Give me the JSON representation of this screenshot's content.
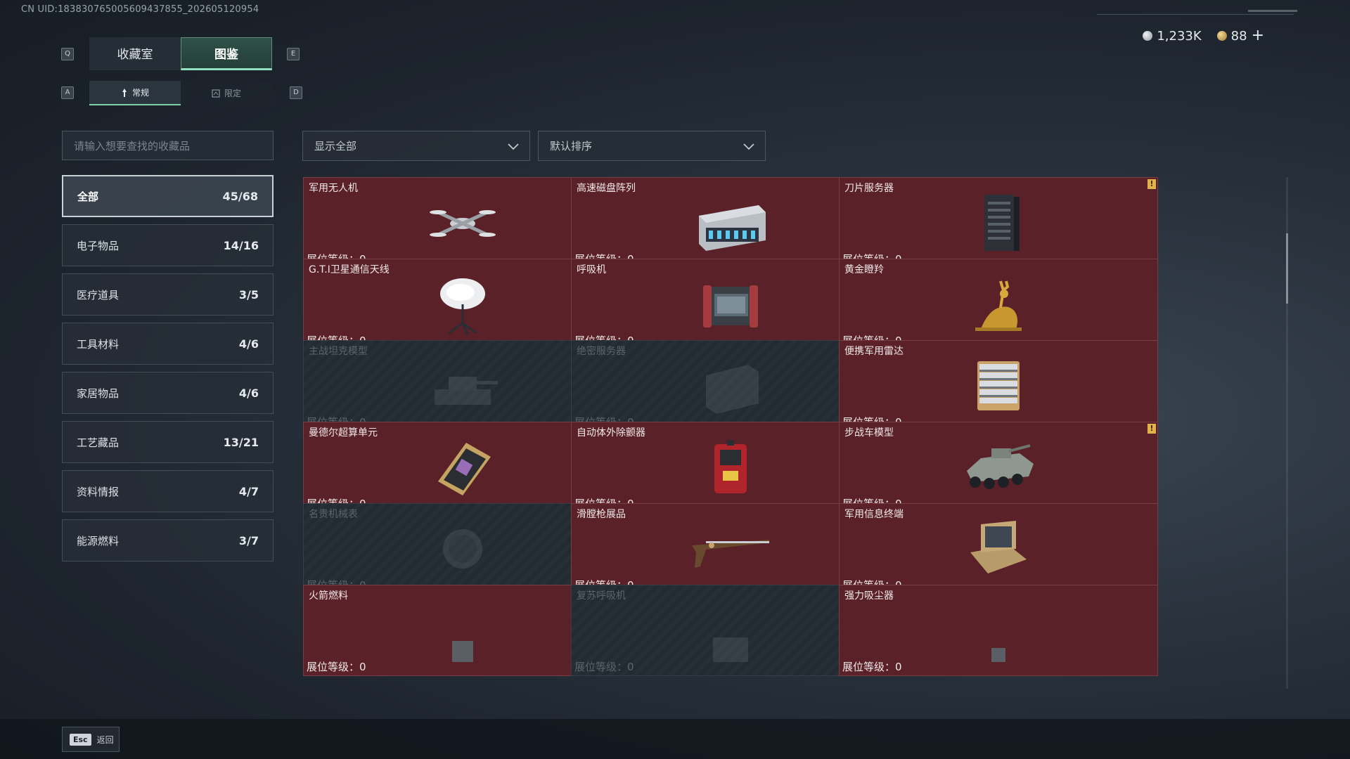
{
  "uid_text": "CN UID:183830765005609437855_202605120954",
  "currency": {
    "silver": "1,233K",
    "gold": "88",
    "plus": "+"
  },
  "keys": {
    "q": "Q",
    "e": "E",
    "a": "A",
    "d": "D"
  },
  "tabs": [
    {
      "label": "收藏室",
      "active": false
    },
    {
      "label": "图鉴",
      "active": true
    }
  ],
  "subtabs": [
    {
      "label": "常规",
      "active": true
    },
    {
      "label": "限定",
      "active": false
    }
  ],
  "search": {
    "placeholder": "请输入想要查找的收藏品"
  },
  "categories": [
    {
      "label": "全部",
      "count": "45/68",
      "active": true
    },
    {
      "label": "电子物品",
      "count": "14/16"
    },
    {
      "label": "医疗道具",
      "count": "3/5"
    },
    {
      "label": "工具材料",
      "count": "4/6"
    },
    {
      "label": "家居物品",
      "count": "4/6"
    },
    {
      "label": "工艺藏品",
      "count": "13/21"
    },
    {
      "label": "资料情报",
      "count": "4/7"
    },
    {
      "label": "能源燃料",
      "count": "3/7"
    }
  ],
  "filter": {
    "show": "显示全部",
    "sort": "默认排序"
  },
  "level_label": "展位等级：0",
  "items": [
    {
      "name": "军用无人机",
      "icon": "drone-icon",
      "locked": false,
      "mark": false
    },
    {
      "name": "高速磁盘阵列",
      "icon": "disk-array-icon",
      "locked": false,
      "mark": false
    },
    {
      "name": "刀片服务器",
      "icon": "blade-server-icon",
      "locked": false,
      "mark": true
    },
    {
      "name": "G.T.I卫星通信天线",
      "icon": "satellite-dish-icon",
      "locked": false,
      "mark": true
    },
    {
      "name": "呼吸机",
      "icon": "ventilator-icon",
      "locked": false,
      "mark": false
    },
    {
      "name": "黄金瞪羚",
      "icon": "golden-gazelle-icon",
      "locked": false,
      "mark": false
    },
    {
      "name": "主战坦克模型",
      "icon": "tank-model-icon",
      "locked": true,
      "mark": false
    },
    {
      "name": "绝密服务器",
      "icon": "secret-server-icon",
      "locked": true,
      "mark": false
    },
    {
      "name": "便携军用雷达",
      "icon": "portable-radar-icon",
      "locked": false,
      "mark": false
    },
    {
      "name": "曼德尔超算单元",
      "icon": "supercomputer-unit-icon",
      "locked": false,
      "mark": false
    },
    {
      "name": "自动体外除颤器",
      "icon": "defibrillator-icon",
      "locked": false,
      "mark": false
    },
    {
      "name": "步战车模型",
      "icon": "ifv-model-icon",
      "locked": false,
      "mark": true
    },
    {
      "name": "名贵机械表",
      "icon": "mechanical-watch-icon",
      "locked": true,
      "mark": false
    },
    {
      "name": "滑膛枪展品",
      "icon": "musket-icon",
      "locked": false,
      "mark": true
    },
    {
      "name": "军用信息终端",
      "icon": "info-terminal-icon",
      "locked": false,
      "mark": false
    },
    {
      "name": "火箭燃料",
      "icon": "rocket-fuel-icon",
      "locked": false,
      "mark": true
    },
    {
      "name": "复苏呼吸机",
      "icon": "resuscitator-icon",
      "locked": true,
      "mark": false
    },
    {
      "name": "强力吸尘器",
      "icon": "vacuum-icon",
      "locked": false,
      "mark": false
    }
  ],
  "footer": {
    "esc_key": "Esc",
    "esc_label": "返回"
  }
}
